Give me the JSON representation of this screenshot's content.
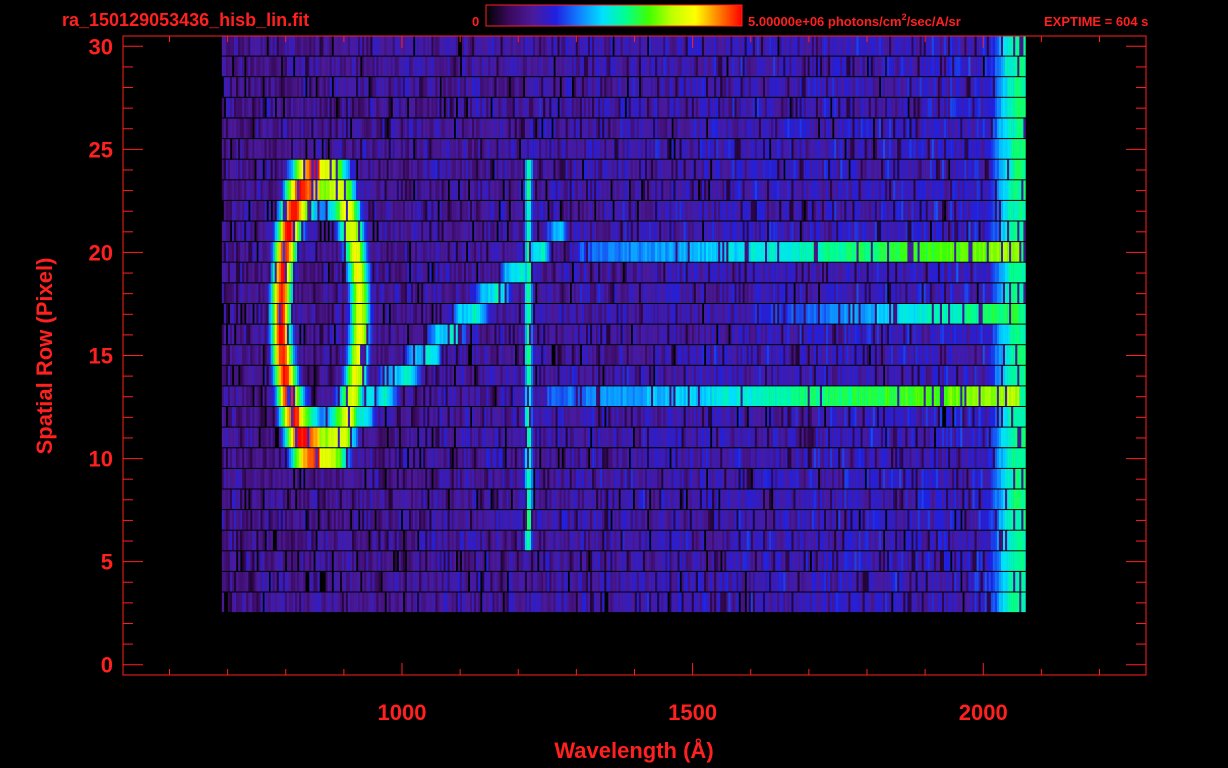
{
  "header": {
    "filename": "ra_150129053436_hisb_lin.fit",
    "colorbar_min_label": "0",
    "colorbar_max_label_main": "5.00000e+06 photons/cm",
    "colorbar_max_label_sup": "2",
    "colorbar_max_label_tail": "/sec/A/sr",
    "exptime_label": "EXPTIME = 604 s"
  },
  "colors": {
    "background": "#000000",
    "axis": "#ff2020",
    "label": "#ff2020",
    "colormap": [
      "#000000",
      "#3a0a5e",
      "#4a1a9a",
      "#2020e0",
      "#1080ff",
      "#00e0ff",
      "#00ff90",
      "#40ff00",
      "#c0ff00",
      "#ffff00",
      "#ff8000",
      "#ff0000"
    ]
  },
  "chart_data": {
    "type": "heatmap",
    "title": "",
    "xlabel": "Wavelength (Å)",
    "ylabel": "Spatial Row (Pixel)",
    "xlim": [
      520,
      2280
    ],
    "ylim": [
      -0.5,
      30.5
    ],
    "x_ticks": [
      1000,
      1500,
      2000
    ],
    "y_ticks": [
      0,
      5,
      10,
      15,
      20,
      25,
      30
    ],
    "grid": false,
    "colorbar": {
      "min": 0,
      "max": 5000000,
      "units": "photons/cm^2/sec/A/sr",
      "placement": "top"
    },
    "data_extent": {
      "x_min": 690,
      "x_max": 2070,
      "row_min": 3,
      "row_max": 30
    },
    "features": [
      {
        "kind": "ring",
        "center_wavelength": 858,
        "center_row": 17,
        "rows": [
          10,
          24
        ],
        "peak": 1.0
      },
      {
        "kind": "vertical_line",
        "wavelength": 1216,
        "rows": [
          6,
          24
        ],
        "peak": 0.55
      },
      {
        "kind": "diagonal_band",
        "from": [
          890,
          11
        ],
        "to": [
          1240,
          20
        ],
        "peak": 0.5
      },
      {
        "kind": "diagonal_band",
        "from": [
          900,
          12
        ],
        "to": [
          1270,
          21
        ],
        "peak": 0.45
      },
      {
        "kind": "horizontal_band",
        "row": 13,
        "from_wavelength": 1250,
        "to_wavelength": 2060,
        "peak": 0.72
      },
      {
        "kind": "horizontal_band",
        "row": 20,
        "from_wavelength": 1300,
        "to_wavelength": 2060,
        "peak": 0.7
      },
      {
        "kind": "horizontal_band",
        "row": 17,
        "from_wavelength": 1600,
        "to_wavelength": 2060,
        "peak": 0.6
      },
      {
        "kind": "continuum_edge",
        "wavelength": 2060,
        "rows": [
          3,
          30
        ],
        "peak": 0.55
      }
    ]
  }
}
